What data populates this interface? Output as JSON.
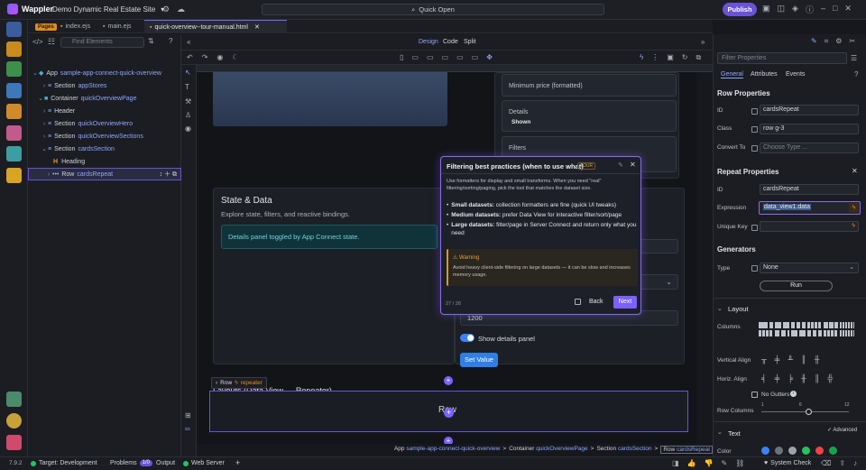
{
  "app": {
    "name": "Wappler",
    "project": "Demo Dynamic Real Estate Site",
    "quick_open": "Quick Open",
    "publish": "Publish"
  },
  "tabs": {
    "pages_badge": "Pages",
    "items": [
      "index.ejs",
      "main.ejs",
      "quick-overview--tour-manual.html"
    ]
  },
  "left": {
    "find_placeholder": "Find Elements",
    "tree": [
      {
        "k": "App",
        "v": "sample-app-connect-quick-overview"
      },
      {
        "k": "Section",
        "v": "appStores"
      },
      {
        "k": "Container",
        "v": "quickOverviewPage"
      },
      {
        "k": "Header",
        "v": ""
      },
      {
        "k": "Section",
        "v": "quickOverviewHero"
      },
      {
        "k": "Section",
        "v": "quickOverviewSections"
      },
      {
        "k": "Section",
        "v": "cardsSection"
      },
      {
        "k": "Heading",
        "v": ""
      },
      {
        "k": "Row",
        "v": "cardsRepeat"
      }
    ]
  },
  "view": {
    "design": "Design",
    "code": "Code",
    "split": "Split"
  },
  "canvas": {
    "min_price": "Minimum price (formatted)",
    "details_label": "Details",
    "details_value": "Shown",
    "filters_label": "Filters",
    "state_title": "State & Data",
    "state_sub": "Explore state, filters, and reactive bindings.",
    "panel_toggled": "Details panel toggled by App Connect state.",
    "value_1200": "1200",
    "show_details": "Show details panel",
    "set_value": "Set Value",
    "row_tag": "Row",
    "repeater_tag": "repeater",
    "section_heading": "Layouts (Data View → Repeater)",
    "row_label": "Row"
  },
  "popup": {
    "title": "Filtering best practices (when to use what)",
    "badge": "TOUR",
    "intro": "Use formatters for display and small transforms. When you need \"real\" filtering/sorting/paging, pick the tool that matches the dataset size.",
    "bullets": [
      {
        "b": "Small datasets:",
        "t": " collection formatters are fine (quick UI tweaks)"
      },
      {
        "b": "Medium datasets:",
        "t": " prefer Data View for interactive filter/sort/page"
      },
      {
        "b": "Large datasets:",
        "t": " filter/page in Server Connect and return only what you need"
      }
    ],
    "warning_title": "Warning",
    "warning_text": "Avoid heavy client-side filtering on large datasets — it can be slow and increases memory usage.",
    "progress": "27 / 28",
    "back": "Back",
    "next": "Next"
  },
  "right": {
    "search_placeholder": "Filter Properties",
    "tabs": [
      "General",
      "Attributes",
      "Events"
    ],
    "row_props": "Row Properties",
    "id_label": "ID",
    "id_value": "cardsRepeat",
    "class_label": "Class",
    "class_value": "row g-3",
    "convert_label": "Convert To",
    "convert_value": "Choose Type ...",
    "repeat_props": "Repeat Properties",
    "rid_label": "ID",
    "rid_value": "cardsRepeat",
    "expr_label": "Expression",
    "expr_value": "data_view1.data",
    "unique_label": "Unique Key",
    "generators": "Generators",
    "type_label": "Type",
    "type_value": "None",
    "run": "Run",
    "layout": "Layout",
    "columns": "Columns",
    "valign": "Vertical Align",
    "halign": "Horiz. Align",
    "no_gutters": "No Gutters",
    "row_columns": "Row Columns",
    "rc_ticks": [
      "1",
      "6",
      "12"
    ],
    "text": "Text",
    "advanced": "Advanced",
    "color": "Color",
    "swatches": [
      "#3b82f6",
      "#6b7280",
      "#9ca3af",
      "#22c55e",
      "#ef4444",
      "#16a34a"
    ]
  },
  "breadcrumb": {
    "items": [
      {
        "k": "App",
        "v": "sample-app-connect-quick-overview"
      },
      {
        "k": "Container",
        "v": "quickOverviewPage"
      },
      {
        "k": "Section",
        "v": "cardsSection"
      },
      {
        "k": "Row",
        "v": "cardsRepeat"
      }
    ]
  },
  "status": {
    "version": "7.9.2",
    "target": "Target: Development",
    "problems": "Problems",
    "problems_count": "1/0",
    "output": "Output",
    "web_server": "Web Server",
    "system_check": "System Check"
  }
}
